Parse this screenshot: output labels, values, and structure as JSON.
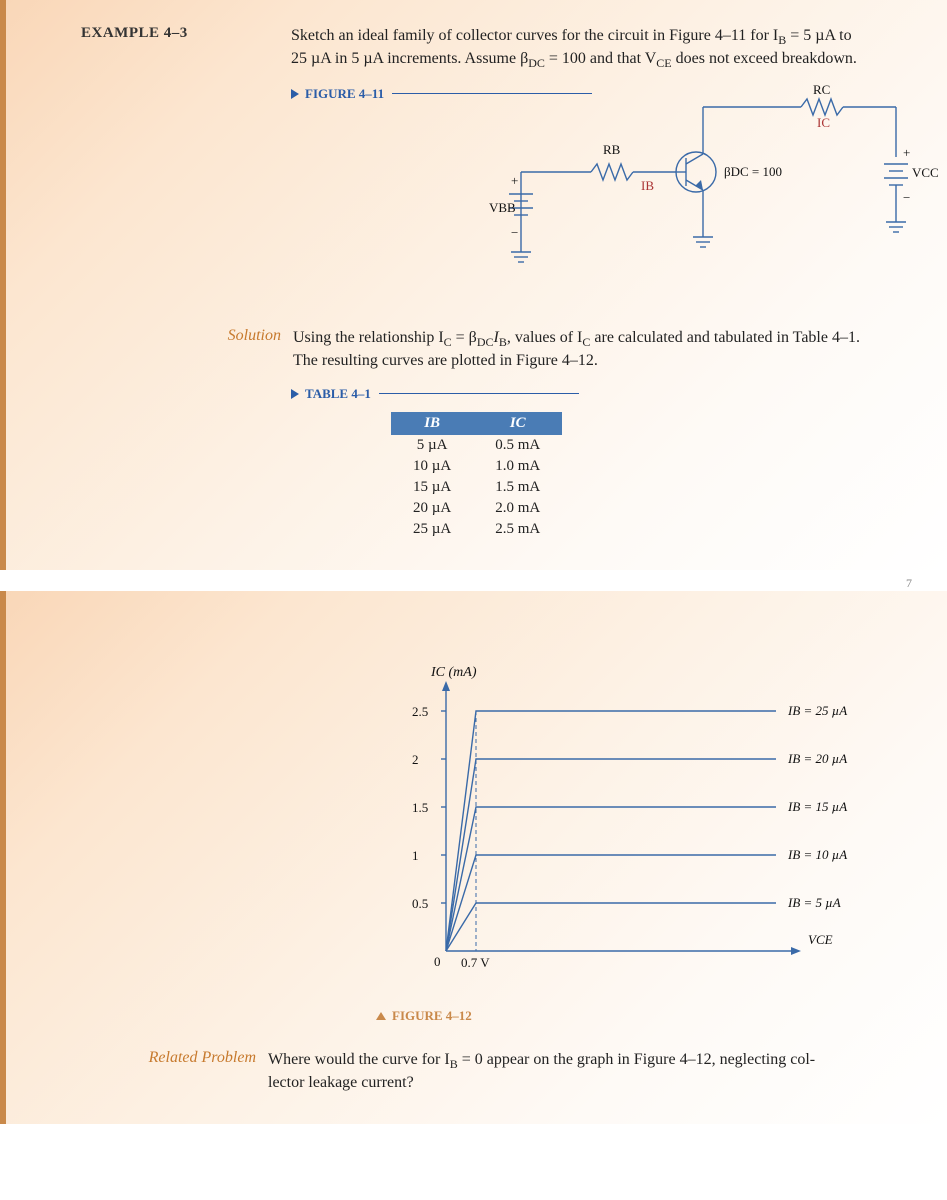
{
  "example": {
    "header": "EXAMPLE 4–3",
    "problem_line1": "Sketch an ideal family of collector curves for the circuit in Figure 4–11 for I",
    "problem_line1b": " = 5 µA to",
    "problem_line2": "25 µA in 5 µA increments. Assume β",
    "problem_line2b": " = 100 and that V",
    "problem_line2c": " does not exceed breakdown.",
    "figure_label": "FIGURE 4–11"
  },
  "circuit": {
    "vbb": "VBB",
    "rb": "RB",
    "ib": "IB",
    "beta": "βDC = 100",
    "rc": "RC",
    "ic": "IC",
    "vcc": "VCC"
  },
  "solution": {
    "label": "Solution",
    "line1": "Using the relationship I",
    "line1b": " = β",
    "line1c": "I",
    "line1d": ", values of I",
    "line1e": " are calculated and tabulated in Table 4–1.",
    "line2": "The resulting curves are plotted in Figure 4–12.",
    "table_label": "TABLE 4–1"
  },
  "table": {
    "head_ib": "IB",
    "head_ic": "IC",
    "rows": [
      {
        "ib": "5 µA",
        "ic": "0.5 mA"
      },
      {
        "ib": "10 µA",
        "ic": "1.0 mA"
      },
      {
        "ib": "15 µA",
        "ic": "1.5 mA"
      },
      {
        "ib": "20 µA",
        "ic": "2.0 mA"
      },
      {
        "ib": "25 µA",
        "ic": "2.5 mA"
      }
    ]
  },
  "page_num": "7",
  "chart_data": {
    "type": "line",
    "title": "",
    "ylabel": "IC (mA)",
    "xlabel": "VCE",
    "x_break": "0.7 V",
    "ylim": [
      0,
      2.5
    ],
    "yticks": [
      0.5,
      1.0,
      1.5,
      2.0,
      2.5
    ],
    "series": [
      {
        "name": "IB = 25 µA",
        "ic_sat": 2.5
      },
      {
        "name": "IB = 20 µA",
        "ic_sat": 2.0
      },
      {
        "name": "IB = 15 µA",
        "ic_sat": 1.5
      },
      {
        "name": "IB = 10 µA",
        "ic_sat": 1.0
      },
      {
        "name": "IB = 5 µA",
        "ic_sat": 0.5
      }
    ]
  },
  "figure12": {
    "label": "FIGURE 4–12"
  },
  "related": {
    "label": "Related Problem",
    "line1": "Where would the curve for I",
    "line1b": " = 0 appear on the graph in Figure 4–12, neglecting col-",
    "line2": "lector leakage current?"
  }
}
